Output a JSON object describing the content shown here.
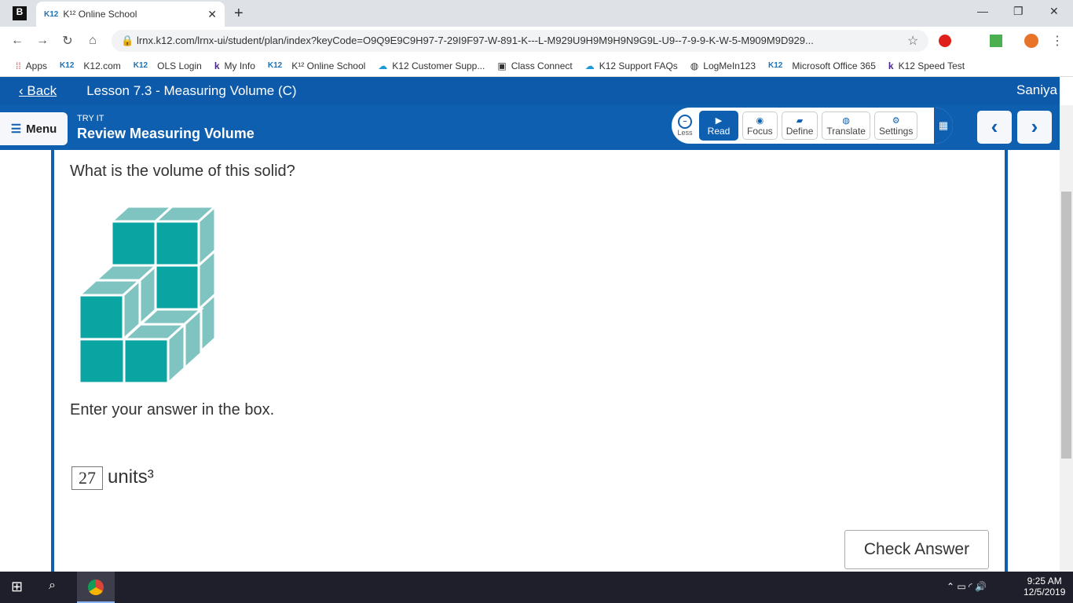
{
  "browser": {
    "tab_title": "K¹² Online School",
    "tab_favicon": "K12",
    "url": "lrnx.k12.com/lrnx-ui/student/plan/index?keyCode=O9Q9E9C9H97-7-29I9F97-W-891-K---L-M929U9H9M9H9N9G9L-U9--7-9-9-K-W-5-M909M9D929...",
    "bookmarks": [
      "Apps",
      "K12.com",
      "OLS Login",
      "My Info",
      "K¹² Online School",
      "K12 Customer Supp...",
      "Class Connect",
      "K12 Support FAQs",
      "LogMeIn123",
      "Microsoft Office 365",
      "K12 Speed Test"
    ]
  },
  "header": {
    "back": "Back",
    "lesson": "Lesson 7.3 - Measuring Volume (C)",
    "user": "Saniya"
  },
  "subheader": {
    "menu": "Menu",
    "kicker": "TRY IT",
    "title": "Review Measuring Volume"
  },
  "tools": {
    "less": "Less",
    "read": "Read",
    "focus": "Focus",
    "define": "Define",
    "translate": "Translate",
    "settings": "Settings"
  },
  "question": {
    "prompt": "What is the volume of this solid?",
    "instruction": "Enter your answer in the box.",
    "answer": "27",
    "unit": "units³",
    "check": "Check Answer"
  },
  "taskbar": {
    "time": "9:25 AM",
    "date": "12/5/2019"
  }
}
